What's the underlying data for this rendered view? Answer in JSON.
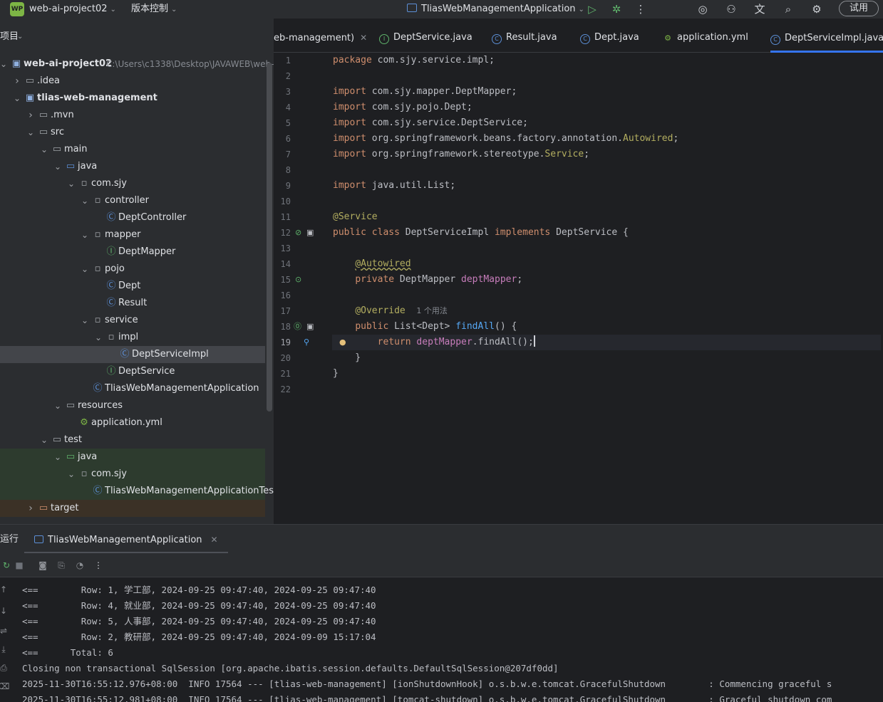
{
  "titlebar": {
    "logo_text": "WP",
    "project_name": "web-ai-project02",
    "vcs_label": "版本控制",
    "run_config": "TliasWebManagementApplication",
    "trial_label": "试用",
    "icons": [
      "run-icon",
      "debug-icon",
      "more-icon",
      "ai-assistant-icon",
      "add-user-icon",
      "translate-icon",
      "search-icon",
      "settings-icon"
    ]
  },
  "project_panel": {
    "title": "项目",
    "root_path": "C:\\Users\\c1338\\Desktop\\JAVAWEB\\web-a",
    "tree": [
      {
        "label": "web-ai-project02",
        "kind": "module",
        "arrow": "▾",
        "depth": 0,
        "bold": true
      },
      {
        "label": ".idea",
        "kind": "folder",
        "arrow": "▸",
        "depth": 1
      },
      {
        "label": "tlias-web-management",
        "kind": "module",
        "arrow": "▾",
        "depth": 1,
        "bold": true
      },
      {
        "label": ".mvn",
        "kind": "folder",
        "arrow": "▸",
        "depth": 2
      },
      {
        "label": "src",
        "kind": "folder",
        "arrow": "▾",
        "depth": 2
      },
      {
        "label": "main",
        "kind": "folder",
        "arrow": "▾",
        "depth": 3
      },
      {
        "label": "java",
        "kind": "src-folder",
        "arrow": "▾",
        "depth": 4
      },
      {
        "label": "com.sjy",
        "kind": "package",
        "arrow": "▾",
        "depth": 5
      },
      {
        "label": "controller",
        "kind": "package",
        "arrow": "▾",
        "depth": 6
      },
      {
        "label": "DeptController",
        "kind": "class",
        "arrow": "",
        "depth": 7
      },
      {
        "label": "mapper",
        "kind": "package",
        "arrow": "▾",
        "depth": 6
      },
      {
        "label": "DeptMapper",
        "kind": "interface",
        "arrow": "",
        "depth": 7
      },
      {
        "label": "pojo",
        "kind": "package",
        "arrow": "▾",
        "depth": 6
      },
      {
        "label": "Dept",
        "kind": "class",
        "arrow": "",
        "depth": 7
      },
      {
        "label": "Result",
        "kind": "class",
        "arrow": "",
        "depth": 7
      },
      {
        "label": "service",
        "kind": "package",
        "arrow": "▾",
        "depth": 6
      },
      {
        "label": "impl",
        "kind": "package",
        "arrow": "▾",
        "depth": 7
      },
      {
        "label": "DeptServiceImpl",
        "kind": "class",
        "arrow": "",
        "depth": 8,
        "selected": true
      },
      {
        "label": "DeptService",
        "kind": "interface",
        "arrow": "",
        "depth": 7
      },
      {
        "label": "TliasWebManagementApplication",
        "kind": "spring-class",
        "arrow": "",
        "depth": 6
      },
      {
        "label": "resources",
        "kind": "res-folder",
        "arrow": "▾",
        "depth": 4
      },
      {
        "label": "application.yml",
        "kind": "yml",
        "arrow": "",
        "depth": 5
      },
      {
        "label": "test",
        "kind": "folder",
        "arrow": "▾",
        "depth": 3
      },
      {
        "label": "java",
        "kind": "test-folder",
        "arrow": "▾",
        "depth": 4,
        "test": true
      },
      {
        "label": "com.sjy",
        "kind": "package",
        "arrow": "▾",
        "depth": 5,
        "test": true
      },
      {
        "label": "TliasWebManagementApplicationTests",
        "kind": "spring-class",
        "arrow": "",
        "depth": 6,
        "test": true
      },
      {
        "label": "target",
        "kind": "folder-excluded",
        "arrow": "▸",
        "depth": 2,
        "excluded": true
      }
    ]
  },
  "editor": {
    "tabs": [
      {
        "label": "eb-management)",
        "icon": "",
        "closable": true
      },
      {
        "label": "DeptService.java",
        "icon": "interface"
      },
      {
        "label": "Result.java",
        "icon": "class"
      },
      {
        "label": "Dept.java",
        "icon": "class"
      },
      {
        "label": "application.yml",
        "icon": "yml"
      },
      {
        "label": "DeptServiceImpl.java",
        "icon": "class",
        "active": true
      }
    ],
    "line_numbers": [
      "1",
      "2",
      "3",
      "4",
      "5",
      "6",
      "7",
      "8",
      "9",
      "10",
      "11",
      "12",
      "13",
      "14",
      "15",
      "16",
      "17",
      "18",
      "19",
      "20",
      "21",
      "22"
    ],
    "usage_hint": "1 个用法"
  },
  "run_panel": {
    "title": "运行",
    "tab_label": "TliasWebManagementApplication",
    "lines": [
      "<==        Row: 1, 学工部, 2024-09-25 09:47:40, 2024-09-25 09:47:40",
      "<==        Row: 4, 就业部, 2024-09-25 09:47:40, 2024-09-25 09:47:40",
      "<==        Row: 5, 人事部, 2024-09-25 09:47:40, 2024-09-25 09:47:40",
      "<==        Row: 2, 教研部, 2024-09-25 09:47:40, 2024-09-09 15:17:04",
      "<==      Total: 6",
      "Closing non transactional SqlSession [org.apache.ibatis.session.defaults.DefaultSqlSession@207df0dd]",
      "2025-11-30T16:55:12.976+08:00  INFO 17564 --- [tlias-web-management] [ionShutdownHook] o.s.b.w.e.tomcat.GracefulShutdown        : Commencing graceful s",
      "2025-11-30T16:55:12.981+08:00  INFO 17564 --- [tlias-web-management] [tomcat-shutdown] o.s.b.w.e.tomcat.GracefulShutdown        : Graceful shutdown com"
    ]
  }
}
